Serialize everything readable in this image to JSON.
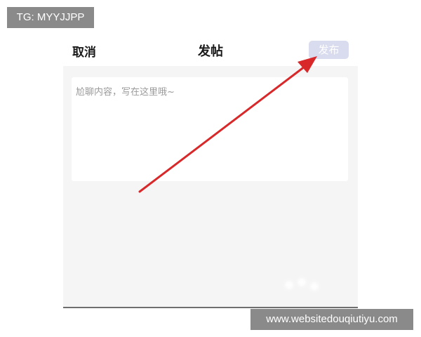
{
  "watermark": {
    "tg_label": "TG: MYYJJPP",
    "website_label": "www.websitedouqiutiyu.com"
  },
  "header": {
    "cancel_label": "取消",
    "title": "发帖",
    "publish_label": "发布"
  },
  "editor": {
    "placeholder": "尬聊内容，写在这里哦~",
    "value": ""
  },
  "colors": {
    "arrow": "#d8282a",
    "publish_button_bg": "#d9dbee",
    "content_bg": "#f5f5f5"
  },
  "annotation": {
    "arrow_icon": "red-arrow-icon"
  }
}
